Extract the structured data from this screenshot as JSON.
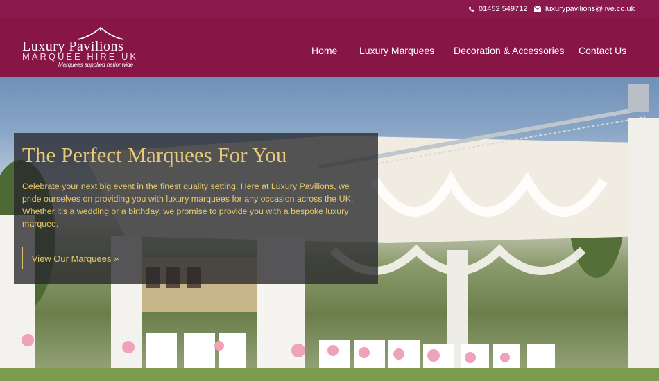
{
  "contact": {
    "phone_icon": "phone-icon",
    "phone": "01452 549712",
    "email_icon": "envelope-icon",
    "email": "luxurypavilions@live.co.uk"
  },
  "logo": {
    "line1": "Luxury Pavilions",
    "line2": "MARQUEE HIRE UK",
    "tagline": "Marquees supplied nationwide"
  },
  "nav": {
    "items": [
      {
        "label": "Home"
      },
      {
        "label": "Luxury Marquees"
      },
      {
        "label": "Decoration & Accessories"
      },
      {
        "label": "Contact Us"
      }
    ]
  },
  "hero": {
    "title": "The Perfect Marquees For You",
    "body": "Celebrate your next big event in the finest quality setting. Here at Luxury Pavilions, we pride ourselves on providing you with luxury marquees for any occasion across the UK. Whether it's a wedding or a birthday, we promise to provide you with a bespoke luxury marquee.",
    "button_label": "View Our Marquees »"
  },
  "colors": {
    "brand": "#871646",
    "gold": "#e6c97a"
  }
}
